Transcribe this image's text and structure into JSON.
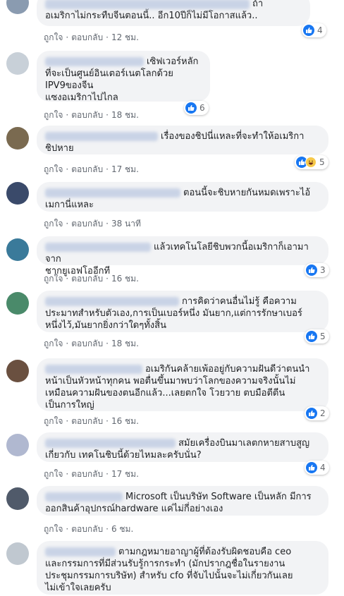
{
  "actions": {
    "like": "ถูกใจ",
    "reply": "ตอบกลับ",
    "sep": "·"
  },
  "comments": [
    {
      "name": "",
      "text": "ถ้า\nอเมริกาไม่กระทืบจีนตอนนี้.. อีก10ปีก็ไม่มีโอกาสแล้ว..",
      "time": "12 ชม.",
      "reactions": "4",
      "react_types": [
        "like"
      ],
      "avatar_color": "#8a9bb0"
    },
    {
      "name": "",
      "text": "เซิฟเวอร์หลัก\nที่จะเป็นศูนย์อินเตอร์เนตโลกด้วย\nIPV9ของจีน\nแซงอเมริกาไปไกล",
      "time": "18 ชม.",
      "reactions": "6",
      "react_types": [
        "like"
      ],
      "avatar_color": "#c8d0d8"
    },
    {
      "name": "",
      "text": "เรื่องของชิปนี่แหละที่จะทำให้อเมริกา\nชิปหาย",
      "time": "17 ชม.",
      "reactions": "5",
      "react_types": [
        "like",
        "haha"
      ],
      "avatar_color": "#7a6a50"
    },
    {
      "name": "",
      "text": "ตอนนี้จะชิบหายกันหมดเพราะไอ้\nเมกานี่แหละ",
      "time": "38 นาที",
      "reactions": "",
      "react_types": [],
      "avatar_color": "#3a4a6a"
    },
    {
      "name": "",
      "text": "แล้วเทคโนโลยีชิบพวกนี้อเมริกาก็เอามาจาก\nชากยูเอฟโออีกที",
      "time": "16 ชม.",
      "reactions": "3",
      "react_types": [
        "like"
      ],
      "avatar_color": "#3a7a9a"
    },
    {
      "name": "",
      "text": "การคิดว่าคนอื่นไม่รู้ คือความ\nประมาทสำหรับตัวเอง,การเป็นเบอร์หนึ่ง มันยาก,แต่การรักษาเบอร์\nหนึ่งไว้,มันยากยิ่งกว่าใดๆทั้งสิ้น",
      "time": "18 ชม.",
      "reactions": "5",
      "react_types": [
        "like"
      ],
      "avatar_color": "#4a8a6a"
    },
    {
      "name": "",
      "text": "อเมริกันคล้ายเพ้ออยู่กับความฝันดีว่าตนนำ\nหน้าเป็นหัวหน้าทุกคน พอตื่นขึ้นมาพบว่าโลกของความจริงนั้นไม่\nเหมือนความฝันของตนอีกแล้ว...เลยตกใจ โวยวาย ตบมือตีตีน\nเป็นการใหญ่",
      "time": "16 ชม.",
      "reactions": "2",
      "react_types": [
        "like"
      ],
      "avatar_color": "#6a5040"
    },
    {
      "name": "",
      "text": "สมัยเครื่องบินมาเลตกหายสาบสูญ\nเกี่ยวกับ เทคโนชิบนี้ด้วยไหมละครับนั่น?",
      "time": "17 ชม.",
      "reactions": "4",
      "react_types": [
        "like"
      ],
      "avatar_color": "#b0b8d0"
    },
    {
      "name": "",
      "text": "Microsoft เป็นบริษัท Software เป็นหลัก มีการ\nออกสินค้าอุปกรณ์hardware แค่ไม่กี่อย่างเอง",
      "time": "6 ชม.",
      "reactions": "",
      "react_types": [],
      "avatar_color": "#505a6a"
    },
    {
      "name": "",
      "text": "ตามกฎหมายอาญาผู้ที่ต้องรับผิดชอบคือ ceo\nและกรรมการที่มีส่วนรับรู้การกระทำ (มักปรากฎชื่อในรายงาน\nประชุมกรรมการบริษัท) สำหรับ cfo ที่จับไปนั้นจะไม่เกี่ยวกันเลย\nไม่เข้าใจเลยครับ",
      "time": "",
      "reactions": "",
      "react_types": [],
      "avatar_color": "#c0c8d0"
    }
  ]
}
